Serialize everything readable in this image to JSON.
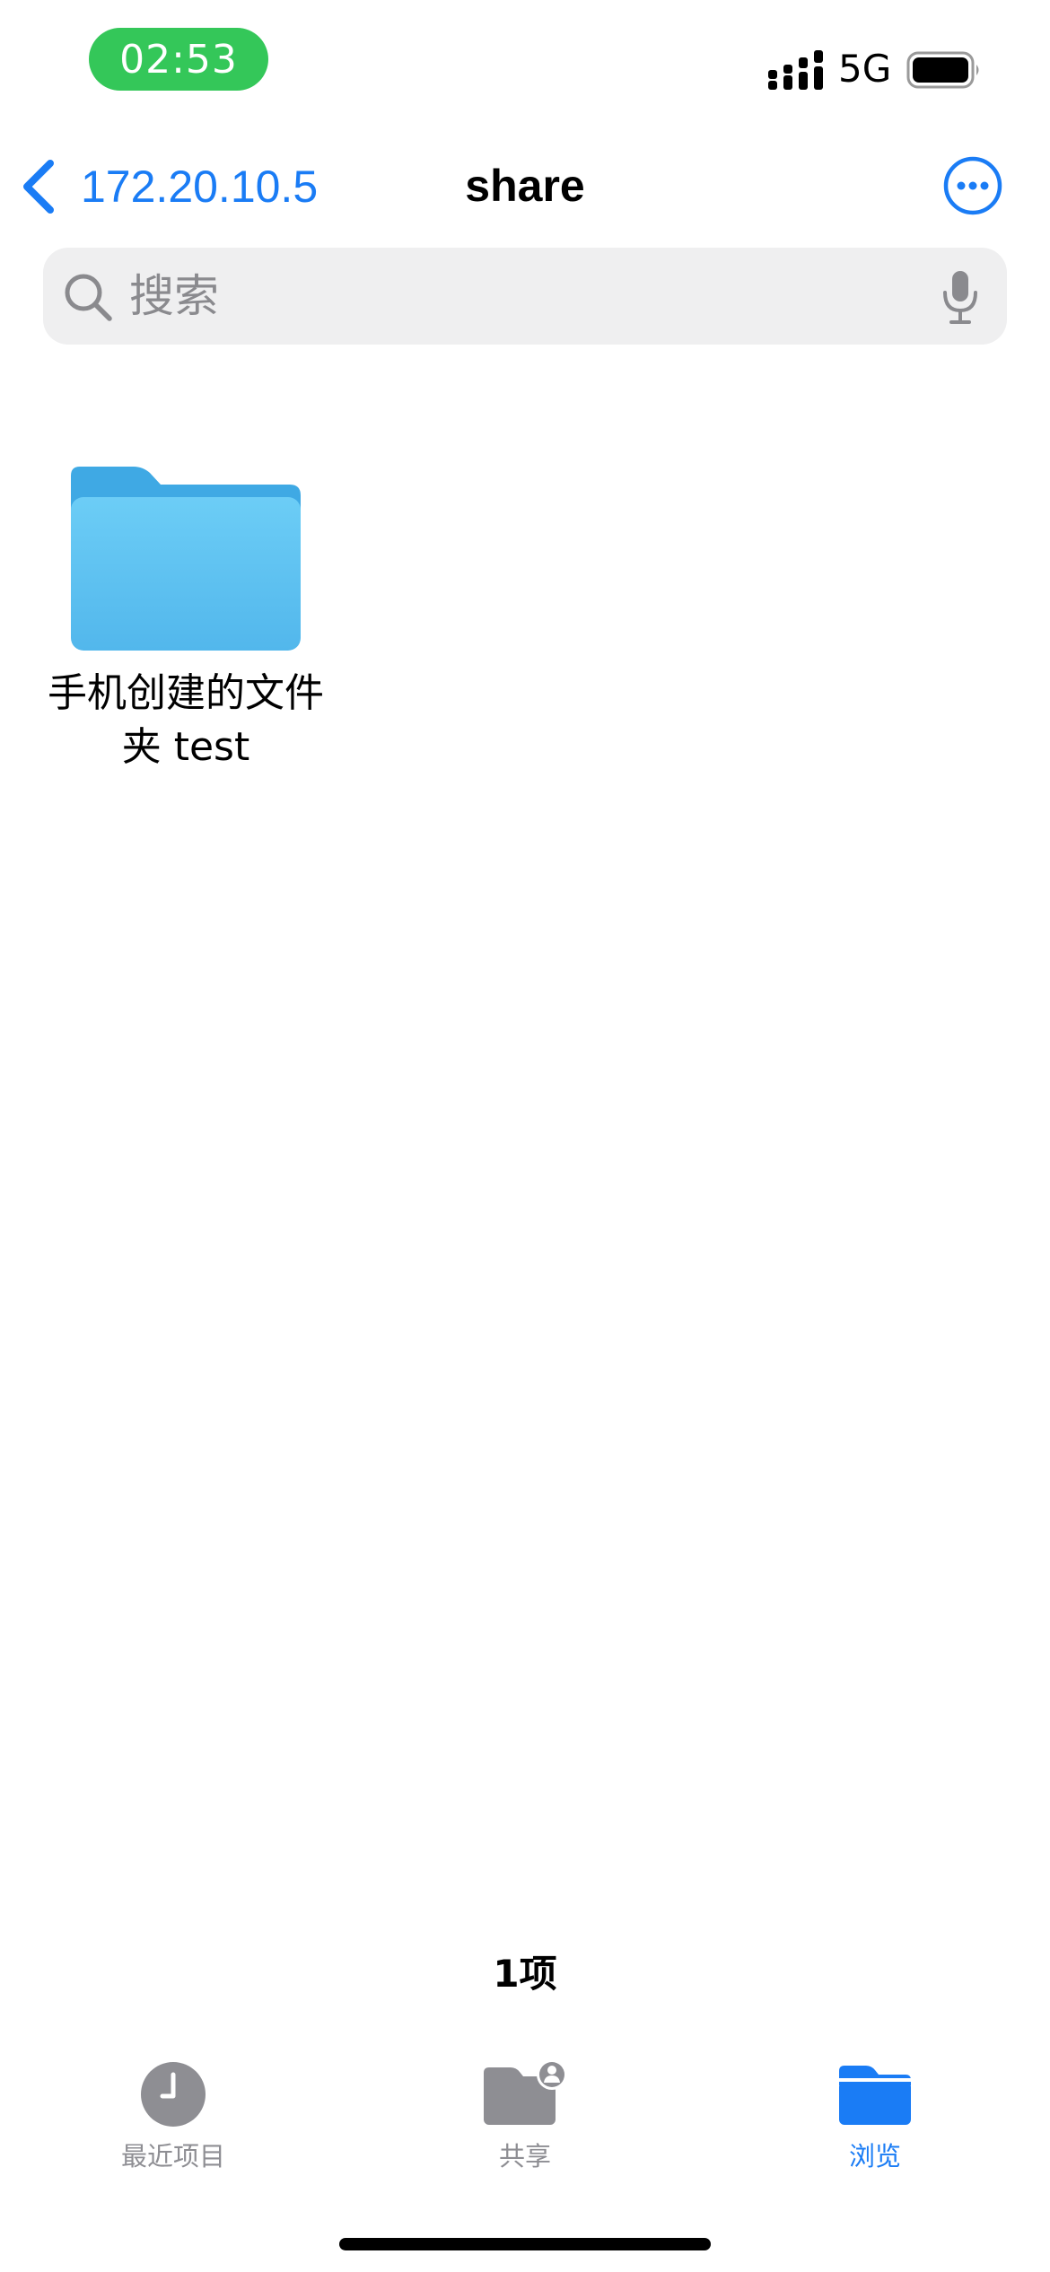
{
  "status_bar": {
    "time": "02:53",
    "network": "5G",
    "time_pill_color": "#34c759"
  },
  "nav": {
    "back_label": "172.20.10.5",
    "title": "share",
    "accent_color": "#1a7cf5",
    "more_icon": "ellipsis-circle-icon"
  },
  "search": {
    "placeholder": "搜索",
    "value": ""
  },
  "items": [
    {
      "name": "手机创建的文件夹 test",
      "icon": "folder-icon"
    }
  ],
  "item_count": "1项",
  "tab_bar": {
    "tabs": [
      {
        "label": "最近项目",
        "icon": "clock-icon",
        "active": false
      },
      {
        "label": "共享",
        "icon": "shared-folder-icon",
        "active": false
      },
      {
        "label": "浏览",
        "icon": "folder-icon",
        "active": true
      }
    ],
    "inactive_color": "#8e8e93",
    "active_color": "#1a7cf5"
  }
}
